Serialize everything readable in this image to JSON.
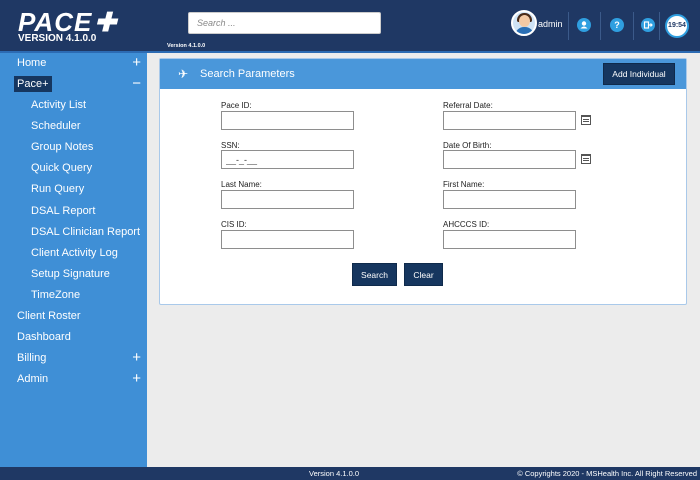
{
  "header": {
    "logo_text": "PACE",
    "logo_version": "VERSION 4.1.0.0",
    "search_placeholder": "Search ...",
    "small_version": "Version 4.1.0.0",
    "user_label": "admin",
    "clock": "19:54",
    "help_glyph": "?"
  },
  "sidebar": {
    "items": [
      {
        "label": "Home",
        "sign": "+"
      },
      {
        "label": "Pace+",
        "sign": "−"
      },
      {
        "label": "Activity List"
      },
      {
        "label": "Scheduler"
      },
      {
        "label": "Group Notes"
      },
      {
        "label": "Quick Query"
      },
      {
        "label": "Run Query"
      },
      {
        "label": "DSAL Report"
      },
      {
        "label": "DSAL Clinician Report"
      },
      {
        "label": "Client Activity Log"
      },
      {
        "label": "Setup Signature"
      },
      {
        "label": "TimeZone"
      },
      {
        "label": "Client Roster"
      },
      {
        "label": "Dashboard"
      },
      {
        "label": "Billing",
        "sign": "+"
      },
      {
        "label": "Admin",
        "sign": "+"
      }
    ]
  },
  "panel": {
    "title": "Search Parameters",
    "add_button": "Add Individual",
    "fields": {
      "pace_id": {
        "label": "Pace ID:",
        "value": ""
      },
      "referral_date": {
        "label": "Referral Date:",
        "value": ""
      },
      "ssn": {
        "label": "SSN:",
        "value": "__-_-__"
      },
      "dob": {
        "label": "Date Of Birth:",
        "value": ""
      },
      "last_name": {
        "label": "Last Name:",
        "value": ""
      },
      "first_name": {
        "label": "First Name:",
        "value": ""
      },
      "cis_id": {
        "label": "CIS ID:",
        "value": ""
      },
      "ahcccs_id": {
        "label": "AHCCCS ID:",
        "value": ""
      }
    },
    "search_button": "Search",
    "clear_button": "Clear"
  },
  "footer": {
    "version": "Version 4.1.0.0",
    "copyright": "© Copyrights  2020 - MSHealth Inc. All Right Reserved"
  },
  "colors": {
    "header_bg": "#1f3864",
    "sidebar_bg": "#3f8fd6",
    "panel_head_bg": "#4a97da",
    "button_bg": "#16365f"
  }
}
